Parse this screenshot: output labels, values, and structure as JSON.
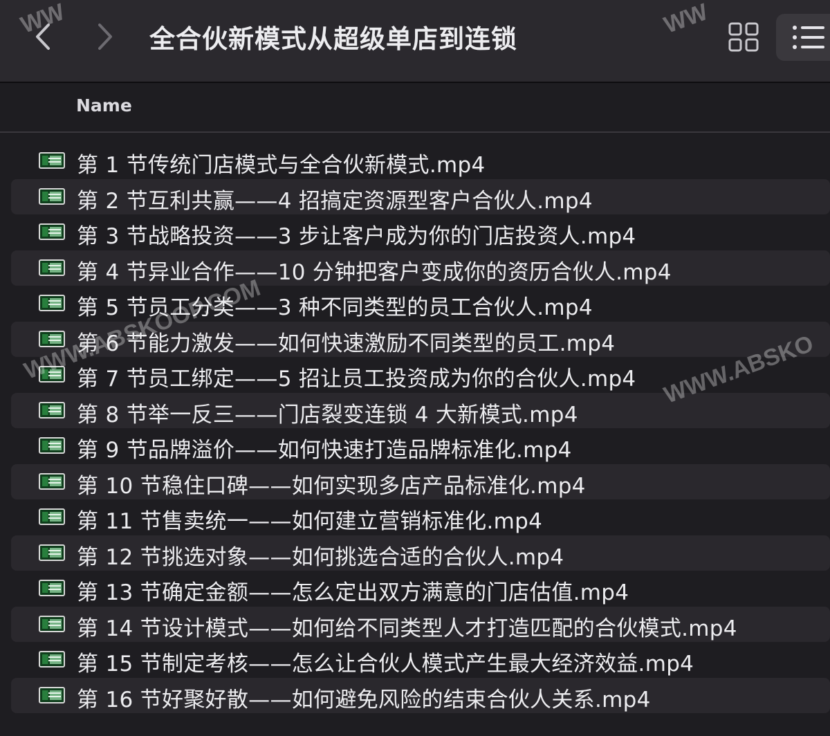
{
  "toolbar": {
    "title": "全合伙新模式从超级单店到连锁"
  },
  "header": {
    "name_column": "Name"
  },
  "files": [
    "第 1 节传统门店模式与全合伙新模式.mp4",
    "第 2 节互利共赢——4 招搞定资源型客户合伙人.mp4",
    "第 3 节战略投资——3 步让客户成为你的门店投资人.mp4",
    "第 4 节异业合作——10 分钟把客户变成你的资历合伙人.mp4",
    "第 5 节员工分类——3 种不同类型的员工合伙人.mp4",
    "第 6 节能力激发——如何快速激励不同类型的员工.mp4",
    "第 7 节员工绑定——5 招让员工投资成为你的合伙人.mp4",
    "第 8 节举一反三——门店裂变连锁 4 大新模式.mp4",
    "第 9 节品牌溢价——如何快速打造品牌标准化.mp4",
    "第 10 节稳住口碑——如何实现多店产品标准化.mp4",
    "第 11 节售卖统一——如何建立营销标准化.mp4",
    "第 12 节挑选对象——如何挑选合适的合伙人.mp4",
    "第 13 节确定金额——怎么定出双方满意的门店估值.mp4",
    "第 14 节设计模式——如何给不同类型人才打造匹配的合伙模式.mp4",
    "第 15 节制定考核——怎么让合伙人模式产生最大经济效益.mp4",
    "第 16 节好聚好散——如何避免风险的结束合伙人关系.mp4"
  ],
  "watermarks": {
    "text_a": "WWW.ABSKOOP.COM",
    "text_b": "WWW.ABSKO",
    "text_c": "WW",
    "text_d": "WW"
  },
  "colors": {
    "toolbar_bg": "#2b292e",
    "list_bg": "#1e1d21",
    "row_alt_bg": "#2a282d",
    "icon_green": "#0f3d1c"
  },
  "icons": {
    "back": "chevron-left-icon",
    "forward": "chevron-right-icon",
    "grid_view": "grid-view-icon",
    "list_view": "list-view-icon",
    "file": "video-file-icon"
  }
}
